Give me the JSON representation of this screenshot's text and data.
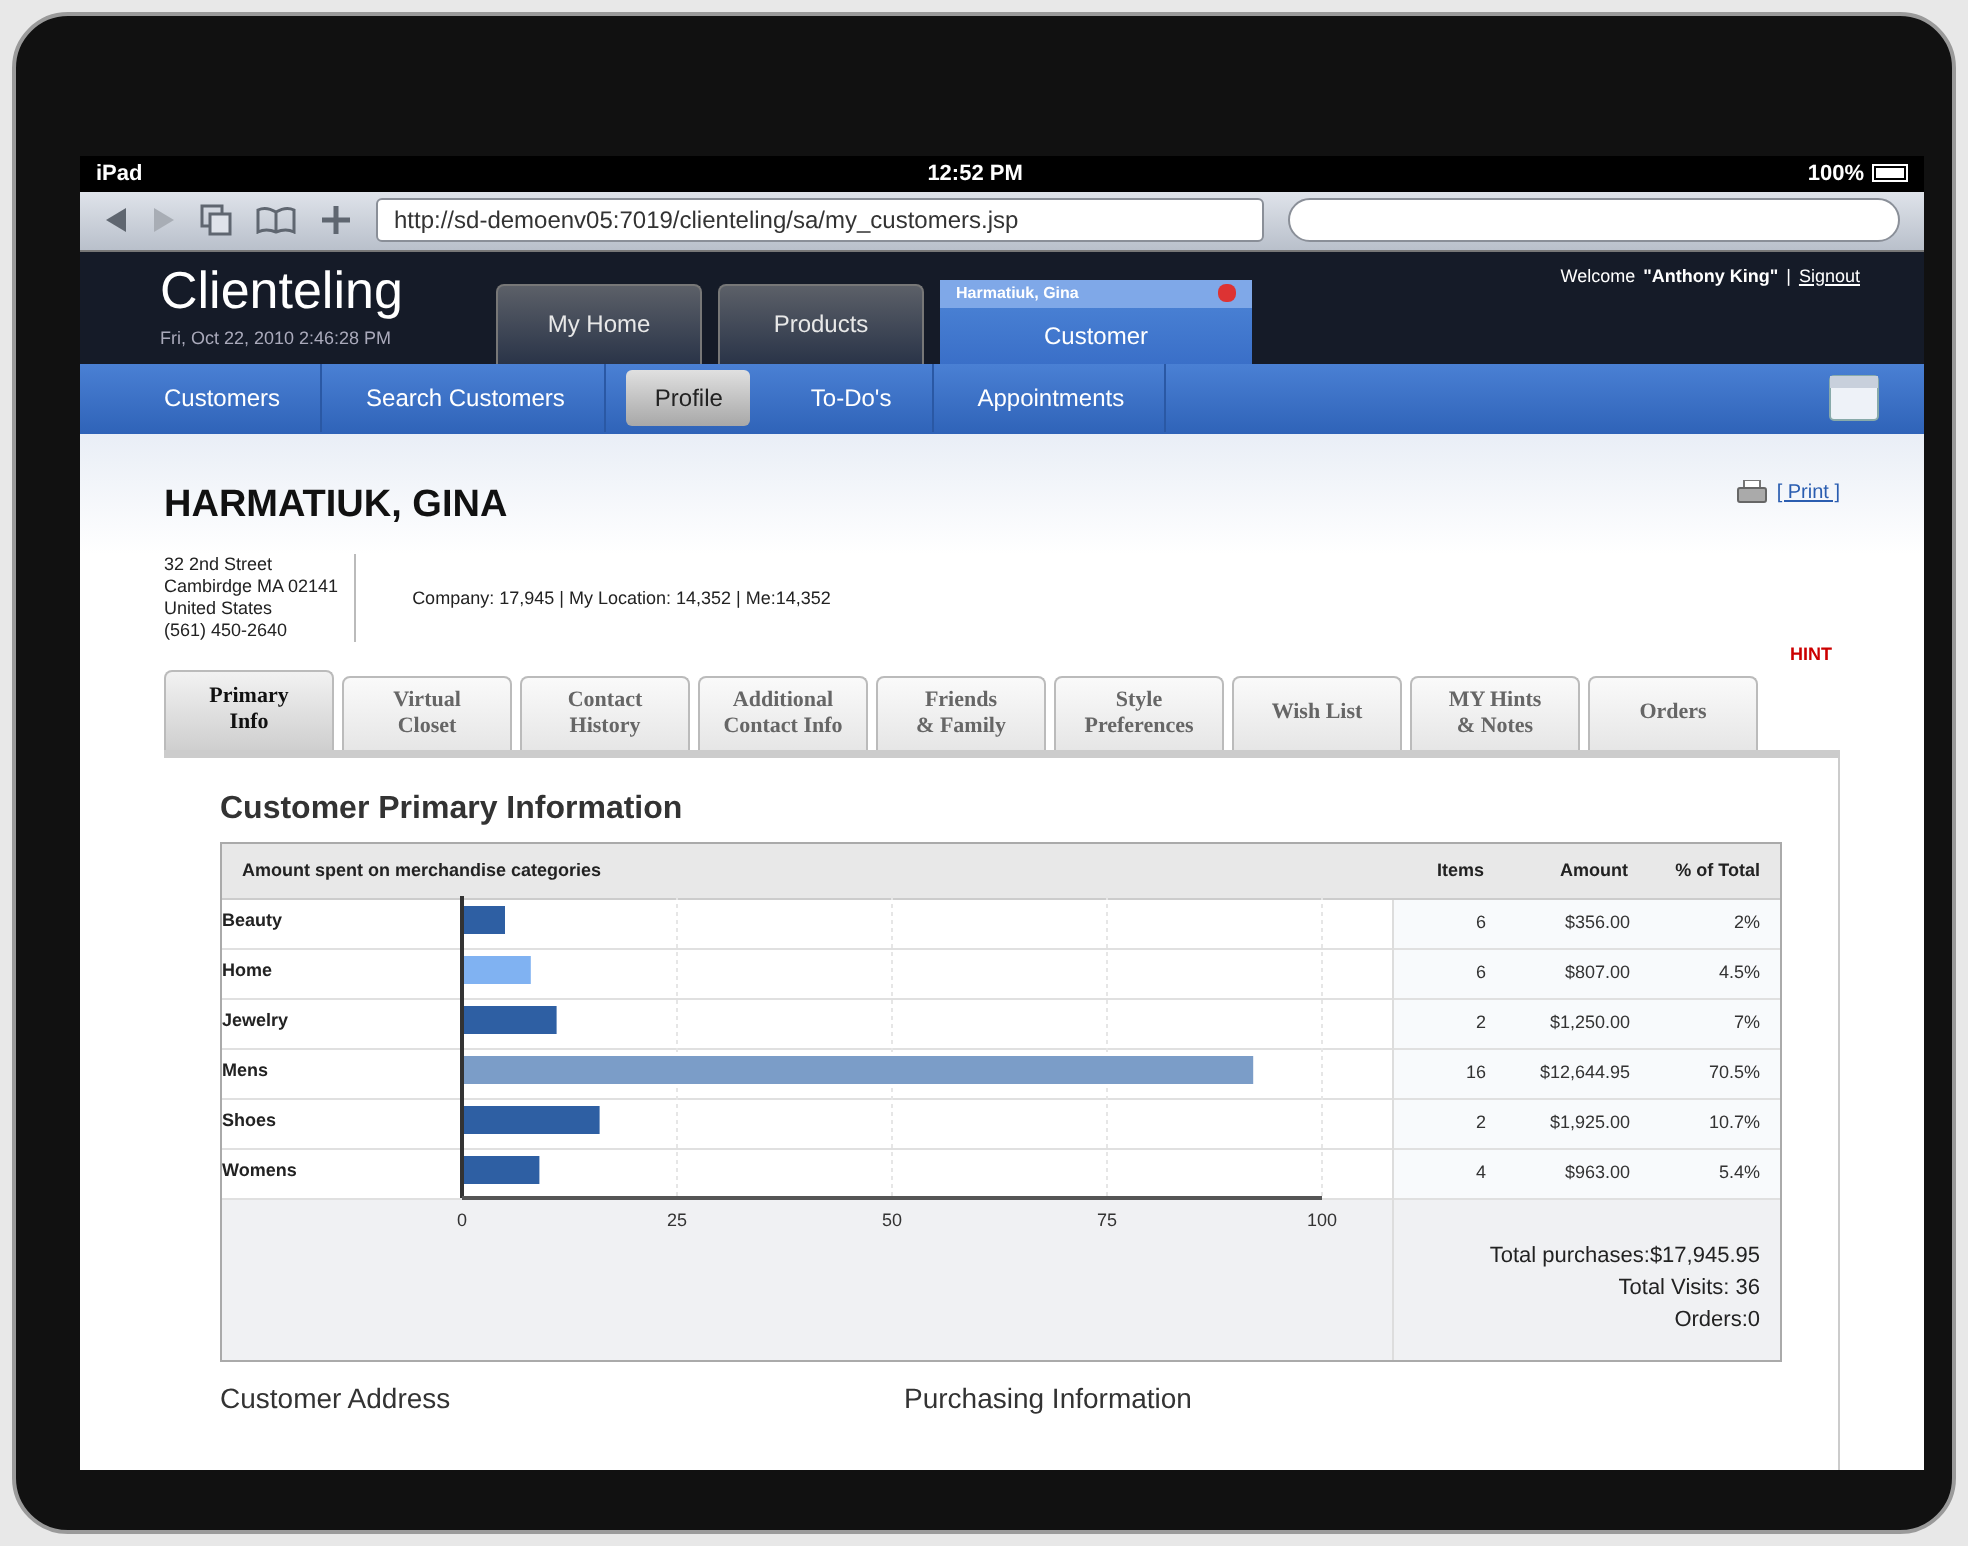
{
  "status_bar": {
    "device": "iPad",
    "time": "12:52 PM",
    "battery": "100%"
  },
  "browser": {
    "url": "http://sd-demoenv05:7019/clienteling/sa/my_customers.jsp"
  },
  "app": {
    "title": "Clienteling",
    "datetime": "Fri, Oct 22, 2010 2:46:28 PM",
    "welcome": "Welcome",
    "user": "\"Anthony King\"",
    "separator": "|",
    "signout": "Signout"
  },
  "main_tabs": [
    {
      "label": "My Home",
      "selected": false
    },
    {
      "label": "Products",
      "selected": false
    },
    {
      "label": "Customer",
      "caption": "Harmatiuk, Gina",
      "selected": true
    }
  ],
  "nav": [
    {
      "label": "Customers",
      "selected": false
    },
    {
      "label": "Search Customers",
      "selected": false
    },
    {
      "label": "Profile",
      "selected": true
    },
    {
      "label": "To-Do's",
      "selected": false
    },
    {
      "label": "Appointments",
      "selected": false
    }
  ],
  "customer": {
    "name": "HARMATIUK, GINA",
    "print": "[ Print ]",
    "address": [
      "32 2nd Street",
      "Cambirdge MA 02141",
      "United States",
      "(561) 450-2640"
    ],
    "stats": "Company: 17,945 | My Location: 14,352 | Me:14,352",
    "hint": "HINT"
  },
  "profile_tabs": [
    {
      "label": "Primary\nInfo",
      "selected": true
    },
    {
      "label": "Virtual\nCloset",
      "selected": false
    },
    {
      "label": "Contact\nHistory",
      "selected": false
    },
    {
      "label": "Additional\nContact Info",
      "selected": false
    },
    {
      "label": "Friends\n& Family",
      "selected": false
    },
    {
      "label": "Style\nPreferences",
      "selected": false
    },
    {
      "label": "Wish List",
      "selected": false
    },
    {
      "label": "MY Hints\n& Notes",
      "selected": false
    },
    {
      "label": "Orders",
      "selected": false
    }
  ],
  "section_title": "Customer Primary Information",
  "table": {
    "columns": [
      "Amount spent on merchandise categories",
      "Items",
      "Amount",
      "% of Total"
    ],
    "rows": [
      {
        "items": "6",
        "amount": "$356.00",
        "percent": "2%",
        "color": "#2e5fa3"
      },
      {
        "items": "6",
        "amount": "$807.00",
        "percent": "4.5%",
        "color": "#80b2f2"
      },
      {
        "items": "2",
        "amount": "$1,250.00",
        "percent": "7%",
        "color": "#2e5fa3"
      },
      {
        "items": "16",
        "amount": "$12,644.95",
        "percent": "70.5%",
        "color": "#7b9dc8"
      },
      {
        "items": "2",
        "amount": "$1,925.00",
        "percent": "10.7%",
        "color": "#2e5fa3"
      },
      {
        "items": "4",
        "amount": "$963.00",
        "percent": "5.4%",
        "color": "#2e5fa3"
      }
    ],
    "chart_data": {
      "type": "bar",
      "orientation": "horizontal",
      "categories": [
        "Beauty",
        "Home",
        "Jewelry",
        "Mens",
        "Shoes",
        "Womens"
      ],
      "values": [
        5,
        8,
        11,
        92,
        16,
        9
      ],
      "xlim": [
        0,
        100
      ],
      "grid": true,
      "xticks": [
        0,
        25,
        50,
        75,
        100
      ]
    },
    "totals": [
      "Total purchases:$17,945.95",
      "Total Visits: 36",
      "Orders:0"
    ]
  },
  "sections": [
    "Customer Address",
    "Purchasing Information"
  ]
}
